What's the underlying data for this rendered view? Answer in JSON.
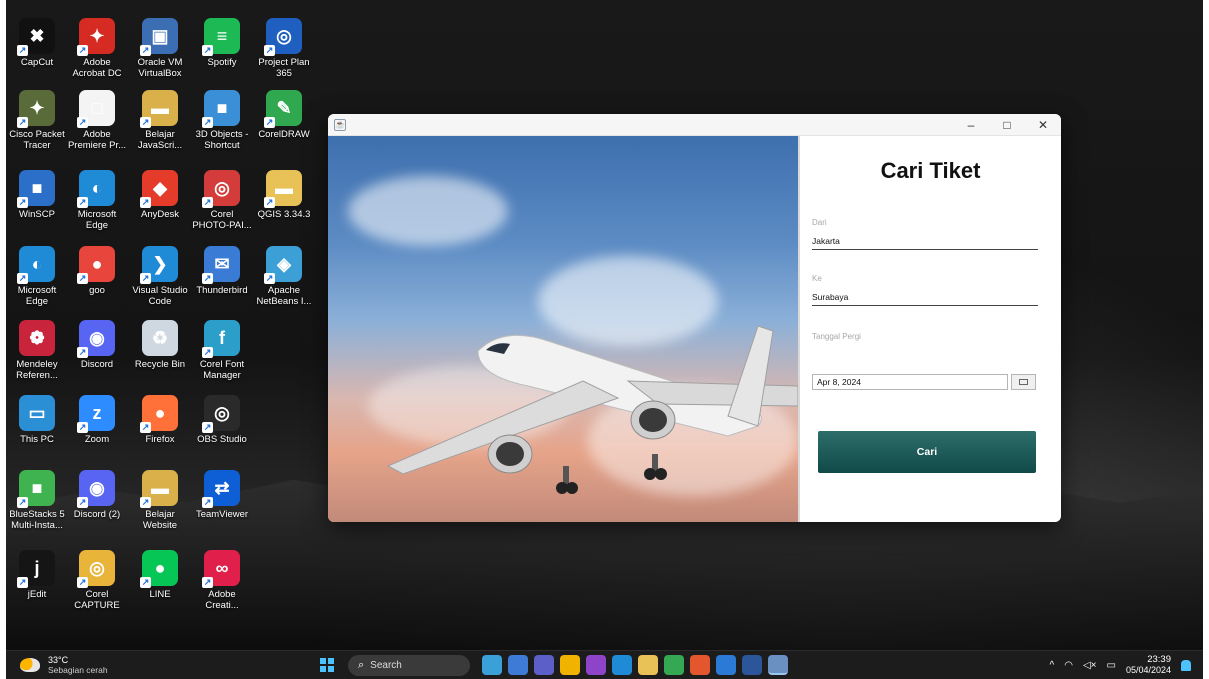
{
  "desktop": {
    "icons": [
      {
        "label": "CapCut",
        "name": "capcut",
        "color": "#111111",
        "glyph": "✖",
        "x": 0,
        "y": 0
      },
      {
        "label": "Adobe Acrobat DC",
        "name": "adobe-acrobat",
        "color": "#d62b22",
        "glyph": "✦",
        "x": 1,
        "y": 0
      },
      {
        "label": "Oracle VM VirtualBox",
        "name": "virtualbox",
        "color": "#3c6eb4",
        "glyph": "▣",
        "x": 2,
        "y": 0
      },
      {
        "label": "Spotify",
        "name": "spotify",
        "color": "#1db954",
        "glyph": "≡",
        "x": 3,
        "y": 0
      },
      {
        "label": "Project Plan 365",
        "name": "project-plan",
        "color": "#1f5fbf",
        "glyph": "◎",
        "x": 4,
        "y": 0
      },
      {
        "label": "Cisco Packet Tracer",
        "name": "cisco-packet-tracer",
        "color": "#5a6b3a",
        "glyph": "✦",
        "x": 0,
        "y": 1
      },
      {
        "label": "Adobe Premiere Pr...",
        "name": "adobe-premiere",
        "color": "#f4f4f4",
        "glyph": "□",
        "x": 1,
        "y": 1
      },
      {
        "label": "Belajar JavaScri...",
        "name": "belajar-javascript",
        "color": "#d9b04a",
        "glyph": "▬",
        "x": 2,
        "y": 1
      },
      {
        "label": "3D Objects - Shortcut",
        "name": "3d-objects",
        "color": "#3a8fd6",
        "glyph": "■",
        "x": 3,
        "y": 1
      },
      {
        "label": "CorelDRAW",
        "name": "coreldraw",
        "color": "#2fa84f",
        "glyph": "✎",
        "x": 4,
        "y": 1
      },
      {
        "label": "WinSCP",
        "name": "winscp",
        "color": "#2b6fc9",
        "glyph": "■",
        "x": 0,
        "y": 2
      },
      {
        "label": "Microsoft Edge",
        "name": "microsoft-edge",
        "color": "#1f8ad6",
        "glyph": "◐",
        "x": 1,
        "y": 2
      },
      {
        "label": "AnyDesk",
        "name": "anydesk",
        "color": "#e53b2b",
        "glyph": "◆",
        "x": 2,
        "y": 2
      },
      {
        "label": "Corel PHOTO-PAI...",
        "name": "corel-photo-paint",
        "color": "#d43b3b",
        "glyph": "◎",
        "x": 3,
        "y": 2
      },
      {
        "label": "QGIS 3.34.3",
        "name": "qgis",
        "color": "#e8c257",
        "glyph": "▬",
        "x": 4,
        "y": 2
      },
      {
        "label": "Microsoft Edge",
        "name": "microsoft-edge-2",
        "color": "#1f8ad6",
        "glyph": "◐",
        "x": 0,
        "y": 3
      },
      {
        "label": "goo",
        "name": "goo",
        "color": "#e8453c",
        "glyph": "●",
        "x": 1,
        "y": 3
      },
      {
        "label": "Visual Studio Code",
        "name": "vscode",
        "color": "#1f8ad6",
        "glyph": "❯",
        "x": 2,
        "y": 3
      },
      {
        "label": "Thunderbird",
        "name": "thunderbird",
        "color": "#3a7bd6",
        "glyph": "✉",
        "x": 3,
        "y": 3
      },
      {
        "label": "Apache NetBeans I...",
        "name": "netbeans",
        "color": "#3c9fd6",
        "glyph": "◈",
        "x": 4,
        "y": 3
      },
      {
        "label": "Mendeley Referen...",
        "name": "mendeley",
        "color": "#c8243b",
        "glyph": "❁",
        "x": 0,
        "y": 4
      },
      {
        "label": "Discord",
        "name": "discord",
        "color": "#5865f2",
        "glyph": "◉",
        "x": 1,
        "y": 4
      },
      {
        "label": "Recycle Bin",
        "name": "recycle-bin",
        "color": "#cfd8e0",
        "glyph": "♻",
        "x": 2,
        "y": 4
      },
      {
        "label": "Corel Font Manager",
        "name": "corel-font-manager",
        "color": "#2b9fc9",
        "glyph": "f",
        "x": 3,
        "y": 4
      },
      {
        "label": "This PC",
        "name": "this-pc",
        "color": "#2b8fd6",
        "glyph": "▭",
        "x": 0,
        "y": 5
      },
      {
        "label": "Zoom",
        "name": "zoom",
        "color": "#2d8cff",
        "glyph": "z",
        "x": 1,
        "y": 5
      },
      {
        "label": "Firefox",
        "name": "firefox",
        "color": "#ff7139",
        "glyph": "●",
        "x": 2,
        "y": 5
      },
      {
        "label": "OBS Studio",
        "name": "obs-studio",
        "color": "#2a2a2a",
        "glyph": "◎",
        "x": 3,
        "y": 5
      },
      {
        "label": "BlueStacks 5 Multi-Insta...",
        "name": "bluestacks",
        "color": "#3fb34f",
        "glyph": "■",
        "x": 0,
        "y": 6
      },
      {
        "label": "Discord (2)",
        "name": "discord-2",
        "color": "#5865f2",
        "glyph": "◉",
        "x": 1,
        "y": 6
      },
      {
        "label": "Belajar Website",
        "name": "belajar-website",
        "color": "#d9b04a",
        "glyph": "▬",
        "x": 2,
        "y": 6
      },
      {
        "label": "TeamViewer",
        "name": "teamviewer",
        "color": "#0e5fd6",
        "glyph": "⇄",
        "x": 3,
        "y": 6
      },
      {
        "label": "jEdit",
        "name": "jedit",
        "color": "#151515",
        "glyph": "j",
        "x": 0,
        "y": 7
      },
      {
        "label": "Corel CAPTURE",
        "name": "corel-capture",
        "color": "#e8b43a",
        "glyph": "◎",
        "x": 1,
        "y": 7
      },
      {
        "label": "LINE",
        "name": "line",
        "color": "#06c755",
        "glyph": "●",
        "x": 2,
        "y": 7
      },
      {
        "label": "Adobe Creati...",
        "name": "adobe-creative-cloud",
        "color": "#e0204a",
        "glyph": "∞",
        "x": 3,
        "y": 7
      }
    ]
  },
  "window": {
    "minimize": "–",
    "maximize": "□",
    "close": "✕",
    "form": {
      "title": "Cari Tiket",
      "dari_label": "Dari",
      "dari_value": "Jakarta",
      "ke_label": "Ke",
      "ke_value": "Surabaya",
      "tanggal_label": "Tanggal Pergi",
      "tanggal_value": "Apr 8, 2024",
      "button_label": "Cari"
    }
  },
  "taskbar": {
    "temperature": "33°C",
    "weather": "Sebagian cerah",
    "search_placeholder": "Search",
    "time": "23:39",
    "date": "05/04/2024",
    "apps": [
      {
        "name": "widgets",
        "color": "#3aa0d8"
      },
      {
        "name": "app-2",
        "color": "#3d7bd6"
      },
      {
        "name": "teams",
        "color": "#5b5fc7"
      },
      {
        "name": "chrome",
        "color": "#f0b400"
      },
      {
        "name": "visual-studio",
        "color": "#8e44c9"
      },
      {
        "name": "edge",
        "color": "#1f8ad6"
      },
      {
        "name": "file-explorer",
        "color": "#e8c257"
      },
      {
        "name": "chrome-2",
        "color": "#34a853"
      },
      {
        "name": "app-9",
        "color": "#e4572e"
      },
      {
        "name": "app-10",
        "color": "#2b7bd6"
      },
      {
        "name": "word",
        "color": "#2b579a"
      },
      {
        "name": "java-app",
        "color": "#6a8fc1"
      }
    ]
  }
}
